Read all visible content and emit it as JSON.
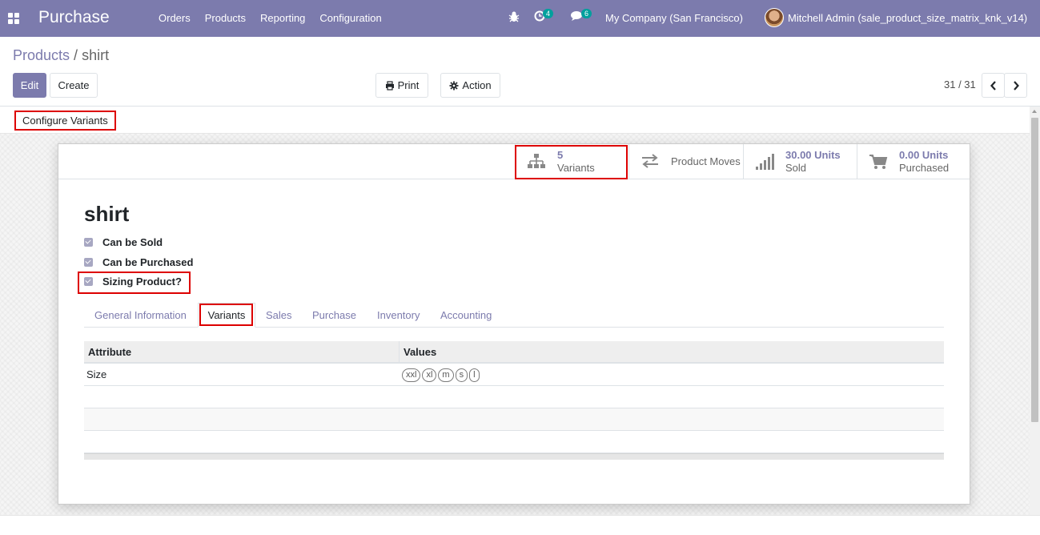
{
  "navbar": {
    "app_name": "Purchase",
    "menu": [
      "Orders",
      "Products",
      "Reporting",
      "Configuration"
    ],
    "activity_count": "4",
    "message_count": "6",
    "company": "My Company (San Francisco)",
    "user": "Mitchell Admin (sale_product_size_matrix_knk_v14)"
  },
  "breadcrumb": {
    "parent": "Products",
    "separator": "/",
    "current": "shirt"
  },
  "buttons": {
    "edit": "Edit",
    "create": "Create",
    "print": "Print",
    "action": "Action"
  },
  "pager": {
    "value": "31 / 31"
  },
  "statusbar": {
    "configure_variants": "Configure Variants"
  },
  "smart_buttons": {
    "variants": {
      "value": "5",
      "label": "Variants"
    },
    "product_moves": {
      "label": "Product Moves"
    },
    "sold": {
      "value": "30.00 Units",
      "label": "Sold"
    },
    "purchased": {
      "value": "0.00 Units",
      "label": "Purchased"
    }
  },
  "product": {
    "name": "shirt",
    "checkboxes": [
      {
        "label": "Can be Sold",
        "checked": true
      },
      {
        "label": "Can be Purchased",
        "checked": true
      },
      {
        "label": "Sizing Product?",
        "checked": true
      }
    ]
  },
  "tabs": [
    "General Information",
    "Variants",
    "Sales",
    "Purchase",
    "Inventory",
    "Accounting"
  ],
  "active_tab": "Variants",
  "attributes_table": {
    "headers": [
      "Attribute",
      "Values"
    ],
    "rows": [
      {
        "attribute": "Size",
        "values": [
          "xxl",
          "xl",
          "m",
          "s",
          "l"
        ]
      }
    ]
  },
  "colors": {
    "brand": "#7c7bad",
    "highlight": "#dd0000",
    "badge": "#00a09d"
  }
}
